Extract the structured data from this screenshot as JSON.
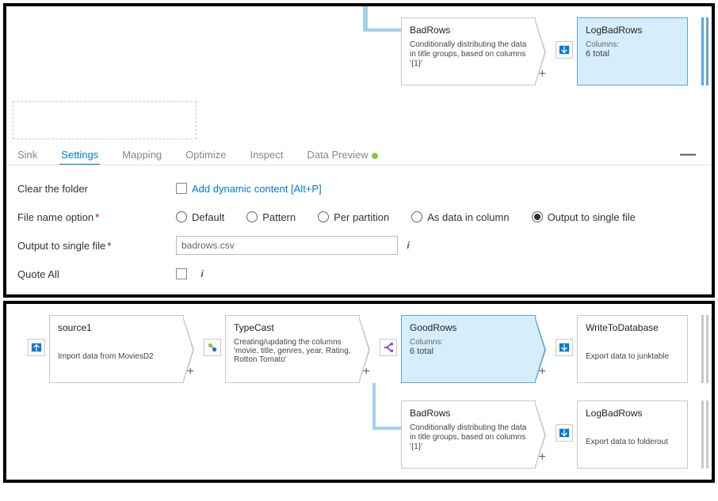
{
  "panel1": {
    "badrows": {
      "title": "BadRows",
      "desc": "Conditionally distributing the data in title groups, based on columns '{1}'"
    },
    "logbadrows": {
      "title": "LogBadRows",
      "meta_label": "Columns:",
      "meta_value": "6 total"
    },
    "tabs": {
      "sink": "Sink",
      "settings": "Settings",
      "mapping": "Mapping",
      "optimize": "Optimize",
      "inspect": "Inspect",
      "data_preview": "Data Preview"
    },
    "form": {
      "clear_folder_label": "Clear the folder",
      "add_dynamic": "Add dynamic content [Alt+P]",
      "file_name_option_label": "File name option",
      "options": {
        "default": "Default",
        "pattern": "Pattern",
        "per_partition": "Per partition",
        "as_data_in_column": "As data in column",
        "output_single": "Output to single file"
      },
      "output_single_label": "Output to single file",
      "output_single_value": "badrows.csv",
      "quote_all_label": "Quote All"
    }
  },
  "panel2": {
    "source1": {
      "title": "source1",
      "desc": "Import data from MoviesD2"
    },
    "typecast": {
      "title": "TypeCast",
      "desc": "Creating/updating the columns 'movie, title, genres, year, Rating, Rotton Tomato'"
    },
    "goodrows": {
      "title": "GoodRows",
      "meta_label": "Columns:",
      "meta_value": "6 total"
    },
    "writedb": {
      "title": "WriteToDatabase",
      "desc": "Export data to junktable"
    },
    "badrows": {
      "title": "BadRows",
      "desc": "Conditionally distributing the data in title groups, based on columns '{1}'"
    },
    "logbadrows": {
      "title": "LogBadRows",
      "desc": "Export data to folderout"
    }
  }
}
